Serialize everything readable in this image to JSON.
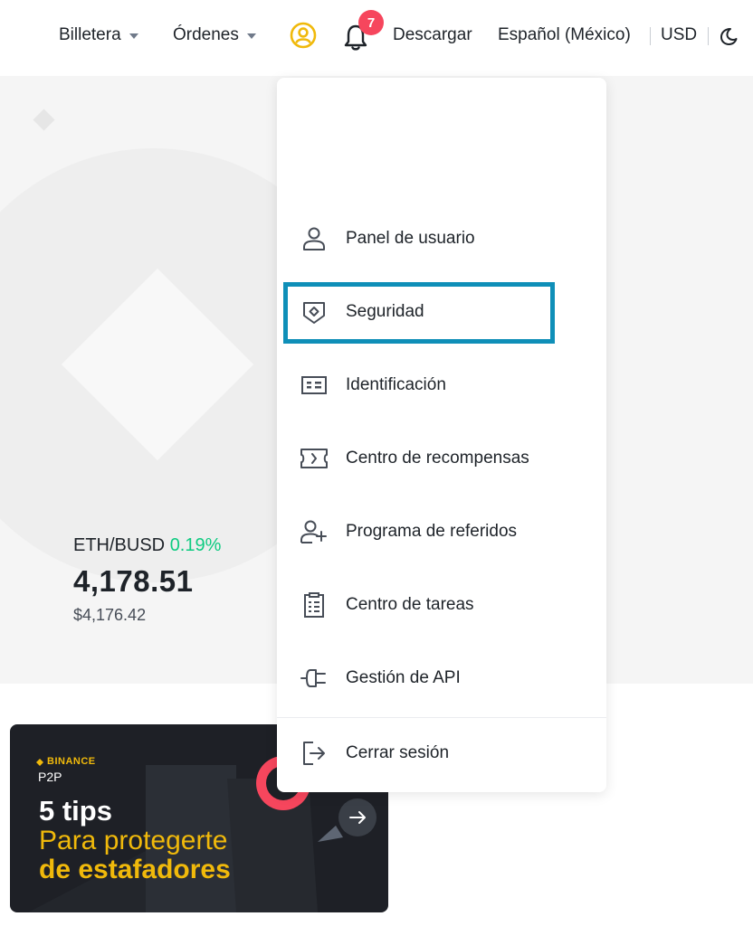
{
  "header": {
    "wallet_label": "Billetera",
    "orders_label": "Órdenes",
    "notification_count": "7",
    "download_label": "Descargar",
    "language_label": "Español (México)",
    "currency_label": "USD"
  },
  "ticker": {
    "pair": "ETH/BUSD",
    "change": "0.19%",
    "price": "4,178.51",
    "usd_price": "$4,176.42"
  },
  "banner": {
    "brand": "BINANCE",
    "product": "P2P",
    "line1": "5 tips",
    "line2": "Para protegerte",
    "line3": "de estafadores"
  },
  "user_menu": {
    "items": [
      {
        "label": "Panel de usuario",
        "icon": "user-icon"
      },
      {
        "label": "Seguridad",
        "icon": "shield-icon"
      },
      {
        "label": "Identificación",
        "icon": "id-card-icon"
      },
      {
        "label": "Centro de recompensas",
        "icon": "ticket-icon"
      },
      {
        "label": "Programa de referidos",
        "icon": "user-plus-icon"
      },
      {
        "label": "Centro de tareas",
        "icon": "clipboard-icon"
      },
      {
        "label": "Gestión de API",
        "icon": "plug-icon"
      }
    ],
    "logout_label": "Cerrar sesión",
    "highlighted_item": "Seguridad"
  },
  "colors": {
    "brand_yellow": "#f0b90b",
    "positive_green": "#0ecb81",
    "badge_red": "#f6465d",
    "highlight_border": "#0f8fb8"
  }
}
